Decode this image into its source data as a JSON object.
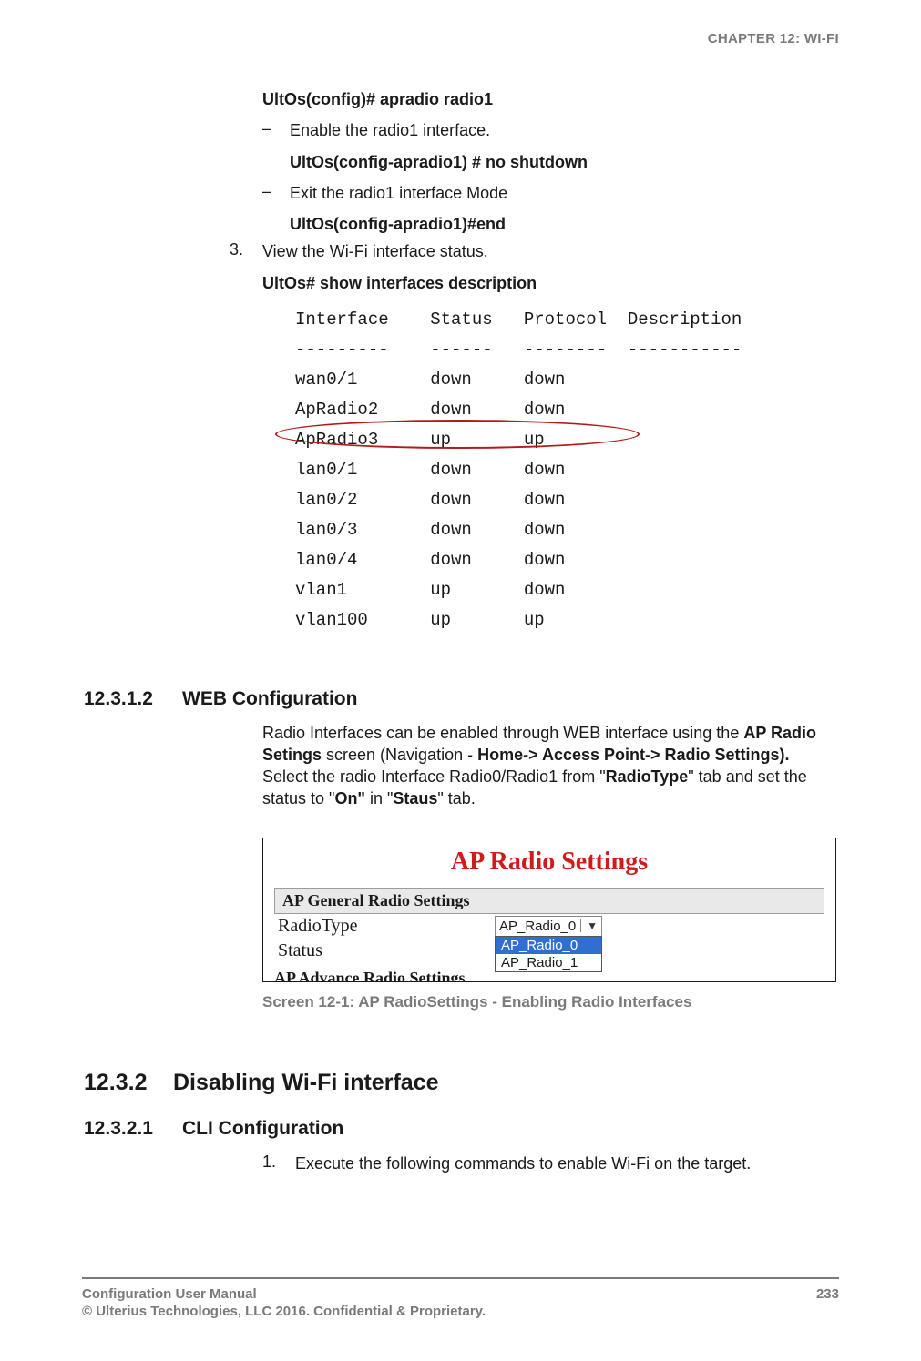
{
  "header": {
    "chapter": "CHAPTER 12: WI-FI"
  },
  "block1": {
    "cmd1": "UltOs(config)# apradio radio1",
    "dash1": "Enable the radio1 interface.",
    "cmd2": "UltOs(config-apradio1) # no shutdown",
    "dash2": "Exit the radio1 interface Mode",
    "cmd3": "UltOs(config-apradio1)#end",
    "step3_num": "3.",
    "step3_text": "View the Wi-Fi interface status.",
    "cmd4": "UltOs# show interfaces description"
  },
  "iface_table": {
    "headers": [
      "Interface",
      "Status",
      "Protocol",
      "Description"
    ],
    "sep": [
      "---------",
      "------",
      "--------",
      "-----------"
    ],
    "rows": [
      [
        "wan0/1",
        "down",
        "down",
        ""
      ],
      [
        "ApRadio2",
        "down",
        "down",
        ""
      ],
      [
        "ApRadio3",
        "up",
        "up",
        ""
      ],
      [
        "lan0/1",
        "down",
        "down",
        ""
      ],
      [
        "lan0/2",
        "down",
        "down",
        ""
      ],
      [
        "lan0/3",
        "down",
        "down",
        ""
      ],
      [
        "lan0/4",
        "down",
        "down",
        ""
      ],
      [
        "vlan1",
        "up",
        "down",
        ""
      ],
      [
        "vlan100",
        "up",
        "up",
        ""
      ]
    ],
    "highlighted_row_index": 2
  },
  "sec_12_3_1_2": {
    "num": "12.3.1.2",
    "title": "WEB Configuration",
    "para_parts": [
      "Radio Interfaces can be enabled through WEB interface using the ",
      "AP Radio Setings",
      " screen (Navigation - ",
      "Home-> Access Point-> Radio Settings).",
      " Select the radio Interface Radio0/Radio1 from \"",
      "RadioType",
      "\" tab and set the status to \"",
      "On\"",
      " in \"",
      "Staus",
      "\" tab."
    ]
  },
  "screenshot": {
    "title": "AP Radio Settings",
    "panel_head": "AP General Radio Settings",
    "row1_label": "RadioType",
    "row2_label": "Status",
    "select_value": "AP_Radio_0",
    "options": [
      "AP_Radio_0",
      "AP_Radio_1"
    ],
    "selected_option_index": 0,
    "cutoff_text": "AP Advance Radio Settings"
  },
  "caption": "Screen 12-1: AP RadioSettings - Enabling Radio Interfaces",
  "sec_12_3_2": {
    "num": "12.3.2",
    "title": "Disabling Wi-Fi interface"
  },
  "sec_12_3_2_1": {
    "num": "12.3.2.1",
    "title": "CLI Configuration",
    "step1_num": "1.",
    "step1_text": "Execute the following commands to enable Wi-Fi on the target."
  },
  "footer": {
    "left": "Configuration User Manual",
    "right": "233",
    "sub": "© Ulterius Technologies, LLC 2016. Confidential & Proprietary."
  }
}
